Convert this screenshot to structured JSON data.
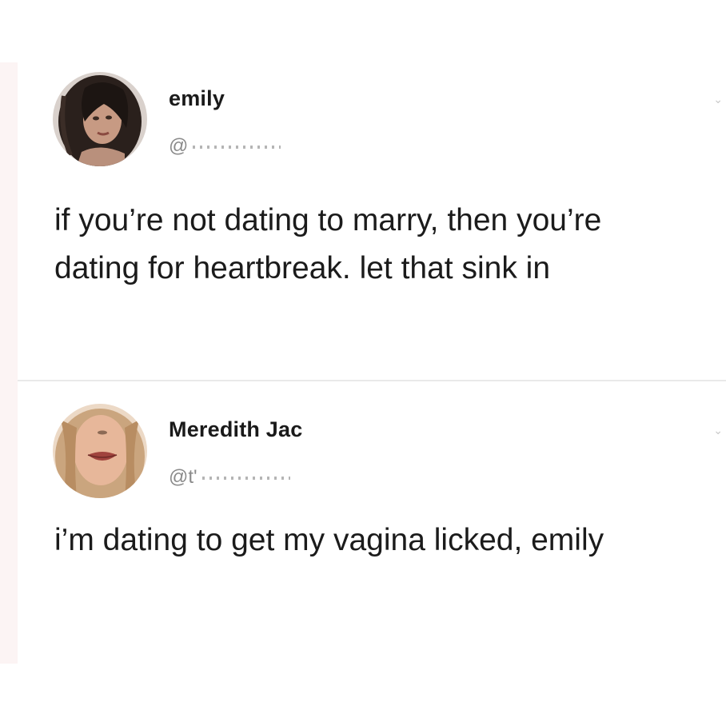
{
  "tweets": [
    {
      "display_name": "emily",
      "handle": "@",
      "text": "if you’re not dating to marry, then you’re dating for heartbreak. let that sink in"
    },
    {
      "display_name": "Meredith Jac",
      "handle": "@t'",
      "text": "i’m dating to get my vagina licked, emily"
    }
  ],
  "icons": {
    "more": "chevron-down-icon"
  }
}
